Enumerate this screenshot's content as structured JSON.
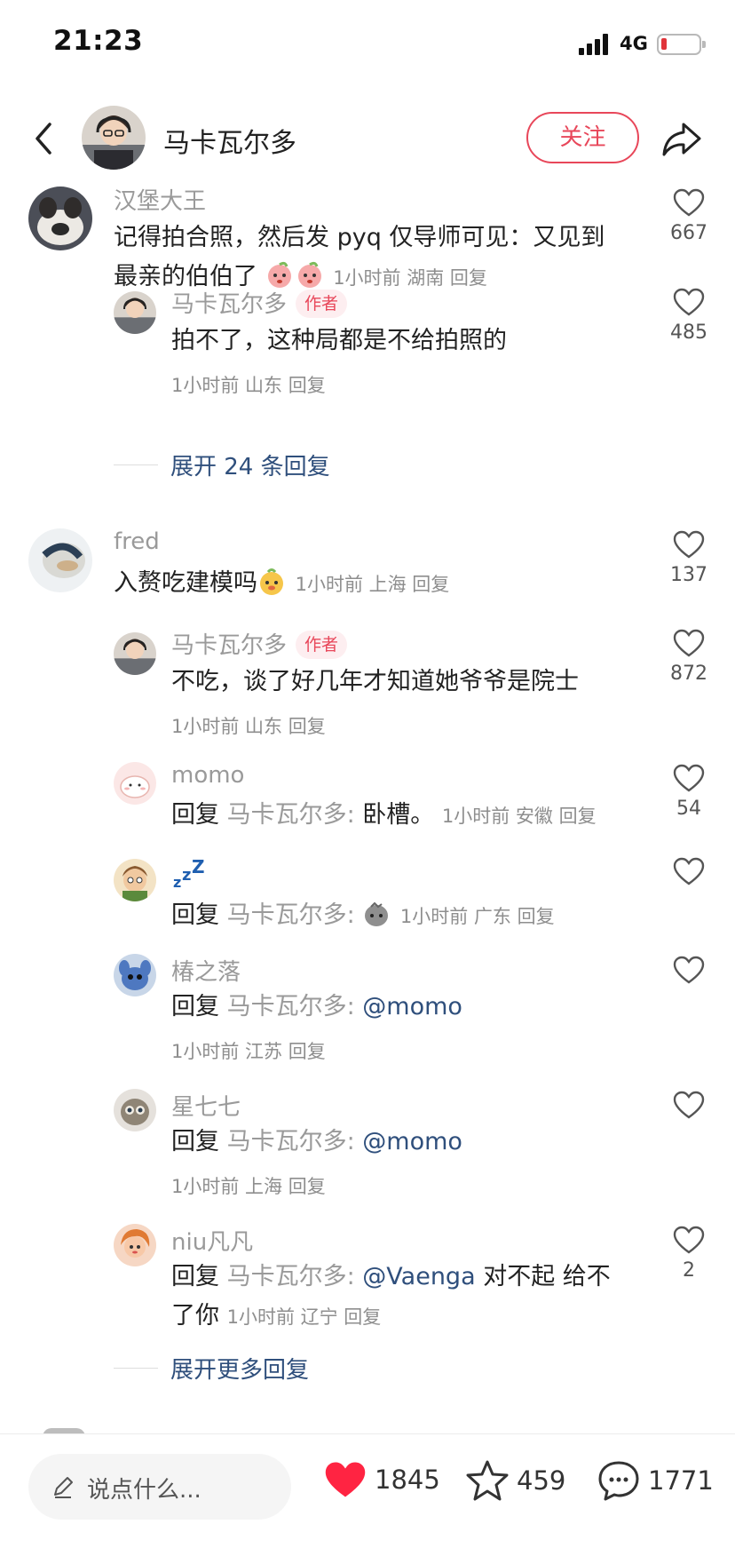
{
  "status_bar": {
    "time": "21:23",
    "network": "4G"
  },
  "header": {
    "author_name": "马卡瓦尔多",
    "follow_label": "关注"
  },
  "comments": [
    {
      "name": "汉堡大王",
      "text": "记得拍合照，然后发 pyq 仅导师可见：又见到",
      "text2": "最亲的伯伯了",
      "meta": "1小时前 湖南 回复",
      "likes": "667"
    },
    {
      "name": "马卡瓦尔多",
      "tag": "作者",
      "text": "拍不了，这种局都是不给拍照的",
      "meta": "1小时前 山东 回复",
      "likes": "485"
    },
    {
      "expand": "展开 24 条回复"
    },
    {
      "name": "fred",
      "text": "入赘吃建模吗",
      "meta": "1小时前 上海 回复",
      "likes": "137"
    },
    {
      "name": "马卡瓦尔多",
      "tag": "作者",
      "text": "不吃，谈了好几年才知道她爷爷是院士",
      "meta": "1小时前 山东 回复",
      "likes": "872"
    },
    {
      "name": "momo",
      "reply_prefix": "回复",
      "reply_to": "马卡瓦尔多:",
      "text": " 卧槽。",
      "meta": "1小时前 安徽 回复",
      "likes": "54"
    },
    {
      "name": "zzZ",
      "reply_prefix": "回复",
      "reply_to": "马卡瓦尔多:",
      "meta": "1小时前 广东 回复"
    },
    {
      "name": "椿之落",
      "reply_prefix": "回复",
      "reply_to": "马卡瓦尔多:",
      "mention": " @momo",
      "meta": "1小时前 江苏 回复"
    },
    {
      "name": "星七七",
      "reply_prefix": "回复",
      "reply_to": "马卡瓦尔多:",
      "mention": " @momo",
      "meta": "1小时前 上海 回复"
    },
    {
      "name": "niu凡凡",
      "reply_prefix": "回复",
      "reply_to": "马卡瓦尔多:",
      "mention": " @Vaenga",
      "text": " 对不起 给不",
      "text2": "了你",
      "meta": "1小时前 辽宁 回复",
      "likes": "2"
    },
    {
      "expand": "展开更多回复"
    }
  ],
  "bottom_bar": {
    "input_placeholder": "说点什么...",
    "likes": "1845",
    "collects": "459",
    "comments": "1771"
  },
  "colors": {
    "accent": "#e8475a",
    "mention": "#2f4f7c",
    "like_filled": "#ff2442"
  }
}
